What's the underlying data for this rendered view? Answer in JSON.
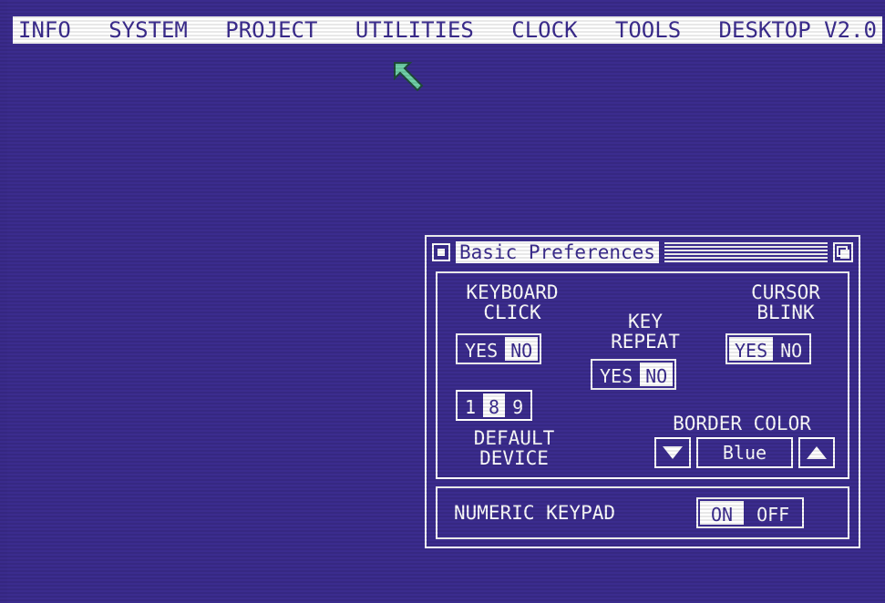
{
  "menubar": {
    "items": [
      "INFO",
      "SYSTEM",
      "PROJECT",
      "UTILITIES",
      "CLOCK",
      "TOOLS",
      "DESKTOP V2.0"
    ]
  },
  "window": {
    "title": "Basic Preferences",
    "keyboard_click": {
      "label_line1": "KEYBOARD",
      "label_line2": "CLICK",
      "options": [
        "YES",
        "NO"
      ],
      "selected": "NO"
    },
    "key_repeat": {
      "label_line1": "KEY",
      "label_line2": "REPEAT",
      "options": [
        "YES",
        "NO"
      ],
      "selected": "NO"
    },
    "cursor_blink": {
      "label_line1": "CURSOR",
      "label_line2": "BLINK",
      "options": [
        "YES",
        "NO"
      ],
      "selected": "YES"
    },
    "default_device": {
      "label_line1": "DEFAULT",
      "label_line2": "DEVICE",
      "options": [
        "1",
        "8",
        "9"
      ],
      "selected": "8"
    },
    "border_color": {
      "label": "BORDER COLOR",
      "value": "Blue"
    },
    "numeric_keypad": {
      "label": "NUMERIC KEYPAD",
      "options": [
        "ON",
        "OFF"
      ],
      "selected": "ON"
    }
  },
  "colors": {
    "background": "#3b2c8e",
    "foreground": "#ffffff",
    "pointer": "#6fd0a8"
  },
  "icons": {
    "pointer": "arrow-pointer-icon",
    "close": "close-box-icon",
    "resize": "resize-box-icon",
    "down": "down-arrow-icon",
    "up": "up-arrow-icon"
  }
}
